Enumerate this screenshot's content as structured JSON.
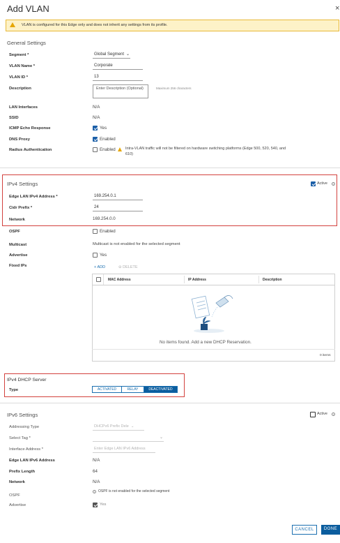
{
  "dialog": {
    "title": "Add VLAN"
  },
  "warning": {
    "text": "VLAN is configured for this Edge only and does not inherit any settings from its profile."
  },
  "general": {
    "title": "General Settings",
    "segment_label": "Segment *",
    "segment_value": "Global Segment",
    "vlan_name_label": "VLAN Name *",
    "vlan_name_value": "Corporate",
    "vlan_id_label": "VLAN ID *",
    "vlan_id_value": "13",
    "description_label": "Description",
    "description_placeholder": "Enter Description (Optional)",
    "description_hint": "Maximum 256 characters",
    "lan_interfaces_label": "LAN Interfaces",
    "lan_interfaces_value": "N/A",
    "ssid_label": "SSID",
    "ssid_value": "N/A",
    "icmp_label": "ICMP Echo Response",
    "icmp_value": "Yes",
    "dns_label": "DNS Proxy",
    "dns_value": "Enabled",
    "radius_label": "Radius Authentication",
    "radius_value": "Enabled",
    "radius_note": "Intra-VLAN traffic will not be filtered on hardware switching platforms (Edge 500, 520, 540, and 610)"
  },
  "ipv4": {
    "title": "IPv4 Settings",
    "active_label": "Active",
    "edge_lan_label": "Edge LAN IPv4 Address *",
    "edge_lan_value": "169.254.0.1",
    "cidr_label": "Cidr Prefix *",
    "cidr_value": "24",
    "network_label": "Network",
    "network_value": "169.254.0.0",
    "ospf_label": "OSPF",
    "ospf_value": "Enabled",
    "multicast_label": "Multicast",
    "multicast_value": "Multicast is not enabled for the selected segment",
    "advertise_label": "Advertise",
    "advertise_value": "Yes",
    "fixed_ips_label": "Fixed IPs",
    "add_label": "ADD",
    "delete_label": "DELETE",
    "columns": [
      "MAC Address",
      "IP Address",
      "Description"
    ],
    "empty_text": "No items found. Add a new DHCP Reservation.",
    "item_count": "0 items"
  },
  "dhcp": {
    "title": "IPv4 DHCP Server",
    "type_label": "Type",
    "options": [
      "ACTIVATED",
      "RELAY",
      "DEACTIVATED"
    ],
    "selected": "DEACTIVATED"
  },
  "ipv6": {
    "title": "IPv6 Settings",
    "active_label": "Active",
    "addressing_label": "Addressing Type",
    "addressing_value": "DHCPv6 Prefix Dele",
    "select_tag_label": "Select Tag *",
    "interface_label": "Interface Address *",
    "interface_placeholder": "Enter Edge LAN IPv6 Address",
    "edge_lan_label": "Edge LAN IPv6 Address",
    "edge_lan_value": "N/A",
    "prefix_label": "Prefix Length",
    "prefix_value": "64",
    "network_label": "Network",
    "network_value": "N/A",
    "ospf_label": "OSPF",
    "ospf_note": "OSPF is not enabled for the selected segment",
    "advertise_label": "Advertise",
    "advertise_value": "Yes"
  },
  "footer": {
    "cancel_label": "CANCEL",
    "done_label": "DONE"
  },
  "colors": {
    "primary": "#0b5d9e",
    "highlight": "#d2413d",
    "warning_bg": "#fdf2c8"
  }
}
